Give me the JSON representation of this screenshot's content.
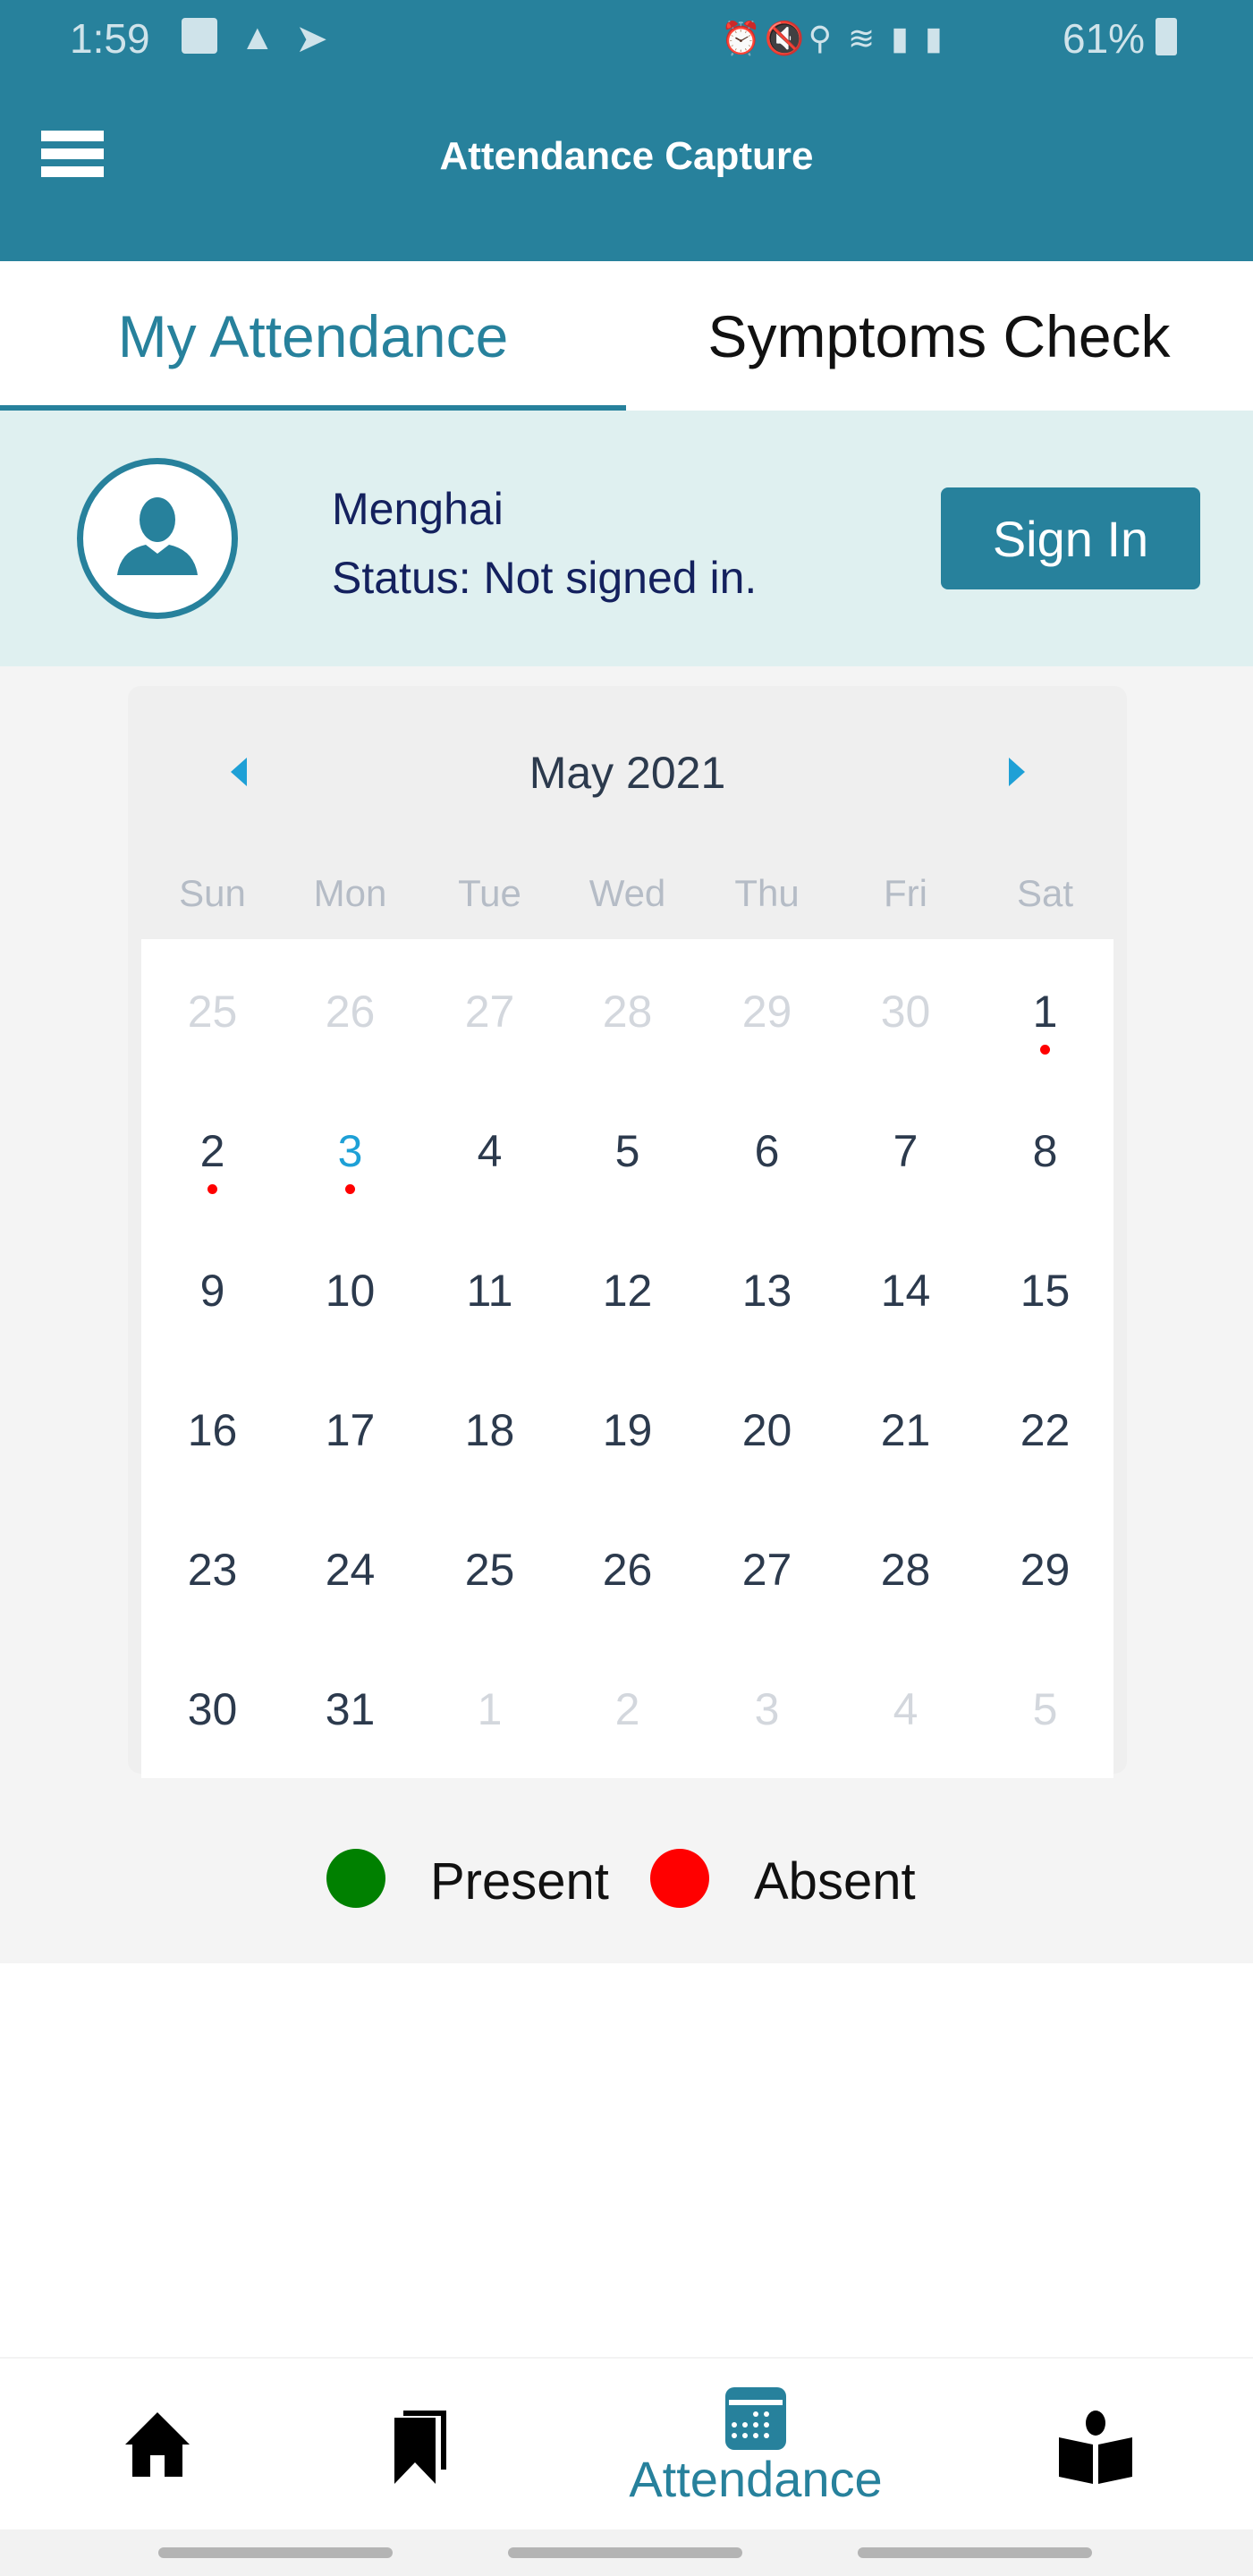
{
  "status_bar": {
    "time": "1:59",
    "battery": "61%",
    "icons": [
      "image-icon",
      "warning-icon",
      "send-icon",
      "alarm-icon",
      "mute-icon",
      "location-icon",
      "wifi-icon",
      "signal-icon",
      "volte-icon",
      "battery-icon"
    ]
  },
  "header": {
    "title": "Attendance Capture"
  },
  "tabs": [
    {
      "label": "My Attendance",
      "active": true
    },
    {
      "label": "Symptoms Check",
      "active": false
    }
  ],
  "profile": {
    "name": "Menghai",
    "status": "Status: Not signed in.",
    "sign_in_label": "Sign In"
  },
  "calendar": {
    "month_label": "May 2021",
    "weekdays": [
      "Sun",
      "Mon",
      "Tue",
      "Wed",
      "Thu",
      "Fri",
      "Sat"
    ],
    "weeks": [
      [
        {
          "d": "25",
          "m": true
        },
        {
          "d": "26",
          "m": true
        },
        {
          "d": "27",
          "m": true
        },
        {
          "d": "28",
          "m": true
        },
        {
          "d": "29",
          "m": true
        },
        {
          "d": "30",
          "m": true
        },
        {
          "d": "1",
          "absent": true
        }
      ],
      [
        {
          "d": "2",
          "absent": true
        },
        {
          "d": "3",
          "absent": true,
          "today": true
        },
        {
          "d": "4"
        },
        {
          "d": "5"
        },
        {
          "d": "6"
        },
        {
          "d": "7"
        },
        {
          "d": "8"
        }
      ],
      [
        {
          "d": "9"
        },
        {
          "d": "10"
        },
        {
          "d": "11"
        },
        {
          "d": "12"
        },
        {
          "d": "13"
        },
        {
          "d": "14"
        },
        {
          "d": "15"
        }
      ],
      [
        {
          "d": "16"
        },
        {
          "d": "17"
        },
        {
          "d": "18"
        },
        {
          "d": "19"
        },
        {
          "d": "20"
        },
        {
          "d": "21"
        },
        {
          "d": "22"
        }
      ],
      [
        {
          "d": "23"
        },
        {
          "d": "24"
        },
        {
          "d": "25"
        },
        {
          "d": "26"
        },
        {
          "d": "27"
        },
        {
          "d": "28"
        },
        {
          "d": "29"
        }
      ],
      [
        {
          "d": "30"
        },
        {
          "d": "31"
        },
        {
          "d": "1",
          "m": true
        },
        {
          "d": "2",
          "m": true
        },
        {
          "d": "3",
          "m": true
        },
        {
          "d": "4",
          "m": true
        },
        {
          "d": "5",
          "m": true
        }
      ]
    ]
  },
  "legend": {
    "present": "Present",
    "absent": "Absent",
    "present_color": "#008000",
    "absent_color": "#ff0000"
  },
  "bottom_nav": {
    "items": [
      {
        "icon": "home-icon"
      },
      {
        "icon": "bookmark-icon"
      },
      {
        "icon": "calendar-icon",
        "label": "Attendance",
        "active": true
      },
      {
        "icon": "reading-icon"
      }
    ]
  },
  "colors": {
    "primary": "#27819c",
    "accent": "#1ea0d6"
  }
}
